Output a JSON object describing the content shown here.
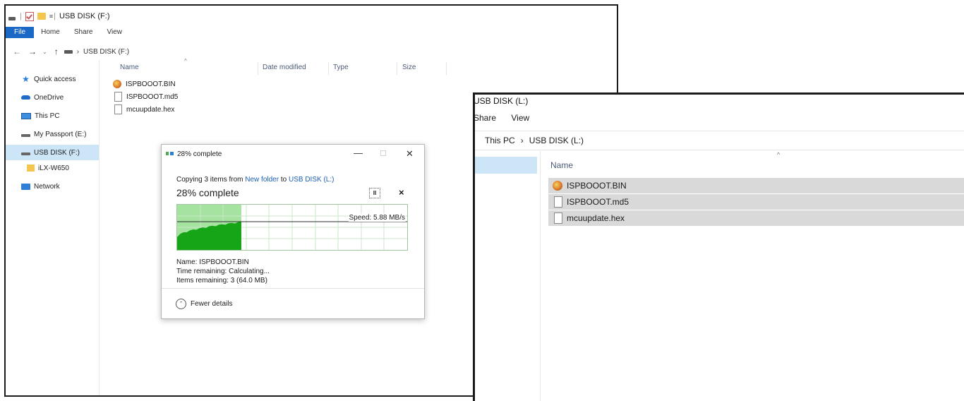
{
  "window_back": {
    "title": "USB DISK (F:)",
    "ribbon_tabs": [
      "File",
      "Home",
      "Share",
      "View"
    ],
    "address": "USB DISK (F:)",
    "nav": [
      {
        "label": "Quick access",
        "icon": "star-icon"
      },
      {
        "label": "OneDrive",
        "icon": "cloud-icon"
      },
      {
        "label": "This PC",
        "icon": "computer-icon"
      },
      {
        "label": "My Passport (E:)",
        "icon": "drive-icon"
      },
      {
        "label": "USB DISK (F:)",
        "icon": "drive-icon",
        "selected": true
      },
      {
        "label": "iLX-W650",
        "icon": "folder-icon"
      },
      {
        "label": "Network",
        "icon": "network-icon"
      }
    ],
    "columns": [
      "Name",
      "Date modified",
      "Type",
      "Size"
    ],
    "files": [
      {
        "name": "ISPBOOOT.BIN",
        "icon": "bin-file-icon"
      },
      {
        "name": "ISPBOOOT.md5",
        "icon": "file-icon"
      },
      {
        "name": "mcuupdate.hex",
        "icon": "file-icon"
      }
    ]
  },
  "copy_dialog": {
    "title": "28% complete",
    "copying_prefix": "Copying 3 items from ",
    "source": "New folder",
    "to_word": " to ",
    "destination": "USB DISK (L:)",
    "percent_text": "28% complete",
    "progress": 0.28,
    "speed": "Speed: 5.88 MB/s",
    "name_line": "Name: ISPBOOOT.BIN",
    "time_line": "Time remaining: Calculating...",
    "items_line": "Items remaining: 3 (64.0 MB)",
    "fewer_details": "Fewer details",
    "colors": {
      "fill": "#a6e3a1",
      "area": "#16a516",
      "grid": "#c9e7c9"
    }
  },
  "window_front": {
    "title": "USB DISK (L:)",
    "ribbon_tabs": [
      "Share",
      "View"
    ],
    "breadcrumb": [
      "This PC",
      "USB DISK (L:)"
    ],
    "column_name": "Name",
    "files": [
      {
        "name": "ISPBOOOT.BIN",
        "icon": "bin-file-icon"
      },
      {
        "name": "ISPBOOOT.md5",
        "icon": "file-icon"
      },
      {
        "name": "mcuupdate.hex",
        "icon": "file-icon"
      }
    ]
  }
}
